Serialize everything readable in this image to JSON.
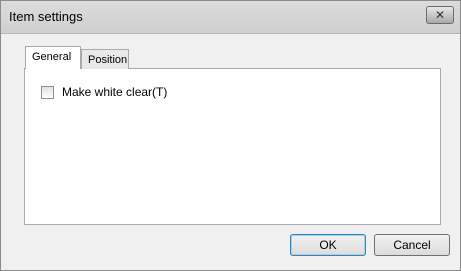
{
  "window": {
    "title": "Item settings",
    "close_label": "✕"
  },
  "tabs": [
    {
      "label": "General",
      "active": true
    },
    {
      "label": "Position",
      "active": false
    }
  ],
  "general": {
    "checkbox_label": "Make white clear(T)",
    "checkbox_checked": false
  },
  "buttons": {
    "ok_label": "OK",
    "cancel_label": "Cancel"
  }
}
